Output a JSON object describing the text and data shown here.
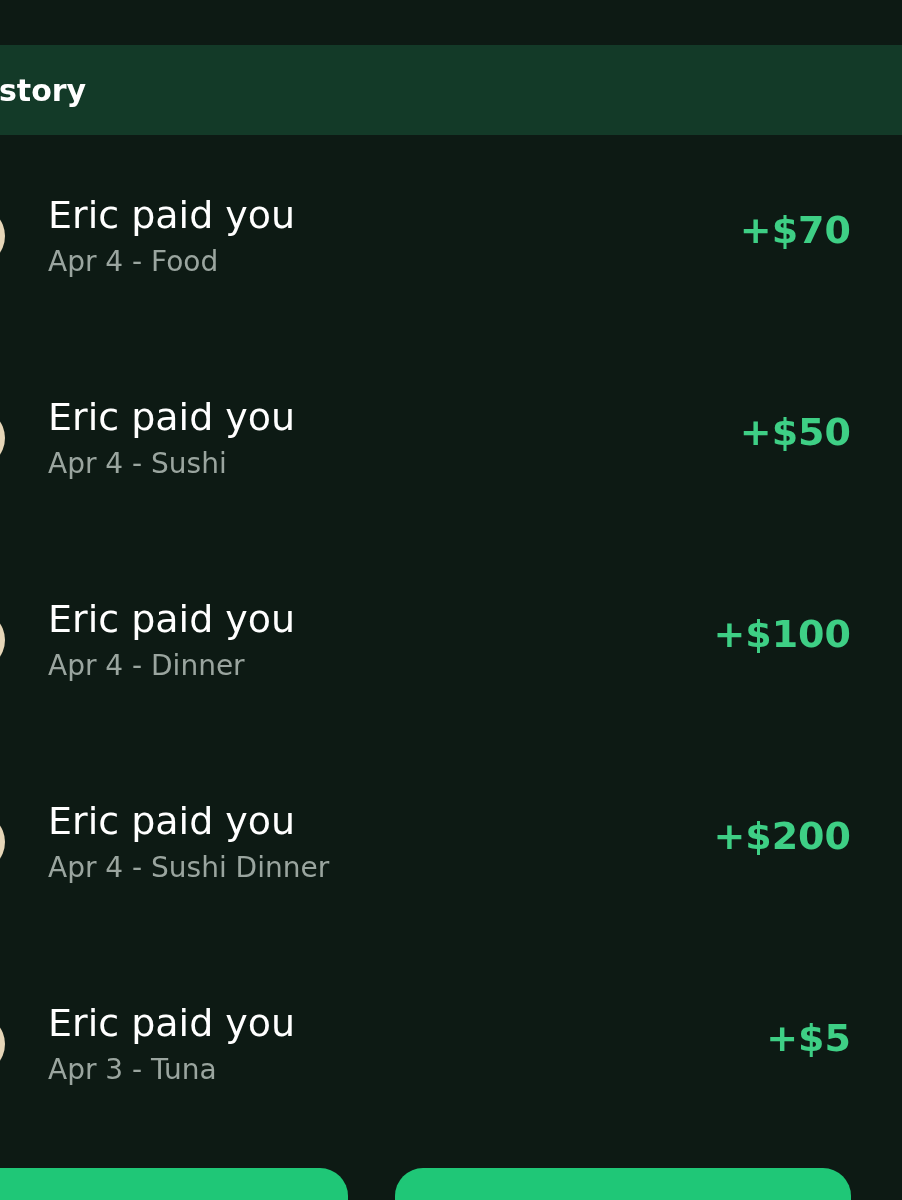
{
  "header": {
    "title": "story"
  },
  "transactions": [
    {
      "title": "Eric paid you",
      "detail": "Apr 4 - Food",
      "amount": "+$70"
    },
    {
      "title": "Eric paid you",
      "detail": "Apr 4 - Sushi",
      "amount": "+$50"
    },
    {
      "title": "Eric paid you",
      "detail": "Apr 4 - Dinner",
      "amount": "+$100"
    },
    {
      "title": "Eric paid you",
      "detail": "Apr 4 - Sushi Dinner",
      "amount": "+$200"
    },
    {
      "title": "Eric paid you",
      "detail": "Apr 3 - Tuna",
      "amount": "+$5"
    }
  ]
}
